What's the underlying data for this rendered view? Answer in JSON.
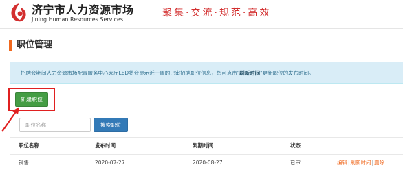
{
  "header": {
    "logo_cn": "济宁市人力资源市场",
    "logo_en": "Jining Human Resources Services",
    "slogan": "聚集·交流·规范·高效"
  },
  "page": {
    "title": "职位管理",
    "notice_prefix": "招聘会期间人力资源市场配置服务中心大厅LED将会显示近一周的已审招聘职位信息，您可点击",
    "notice_link": "刷新时间",
    "notice_suffix": "更新职位的发布时间。"
  },
  "toolbar": {
    "new_button": "新建职位",
    "search_placeholder": "职位名称",
    "search_button": "搜索职位"
  },
  "table": {
    "columns": [
      "职位名称",
      "发布时间",
      "到期时间",
      "状态"
    ],
    "rows": [
      {
        "name": "销售",
        "publish": "2020-07-27",
        "expire": "2020-08-27",
        "status": "已审",
        "actions": [
          "编辑",
          "刷新时间",
          "删除"
        ]
      }
    ]
  },
  "colors": {
    "brand_red": "#d32f2f",
    "accent_orange": "#f0681e",
    "success_green": "#449d44",
    "primary_blue": "#337ab7",
    "info_bg": "#d9edf7",
    "highlight_red": "#e02020"
  }
}
